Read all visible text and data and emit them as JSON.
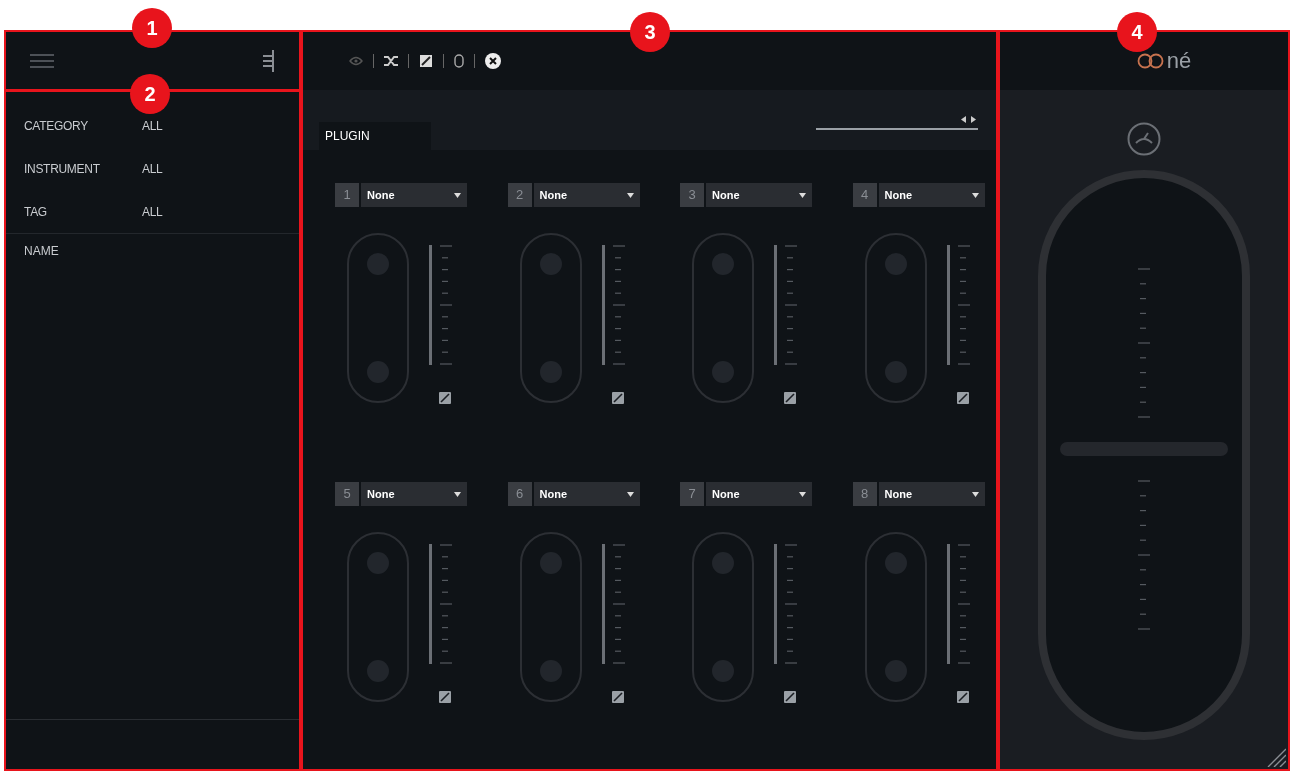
{
  "callouts": [
    "1",
    "2",
    "3",
    "4"
  ],
  "sidebar": {
    "filters": [
      {
        "label": "CATEGORY",
        "value": "ALL"
      },
      {
        "label": "INSTRUMENT",
        "value": "ALL"
      },
      {
        "label": "TAG",
        "value": "ALL"
      }
    ],
    "list_header": "NAME"
  },
  "main": {
    "tab": {
      "label": "PLUGIN",
      "selected": true
    },
    "slots": [
      {
        "number": "1",
        "plugin": "None"
      },
      {
        "number": "2",
        "plugin": "None"
      },
      {
        "number": "3",
        "plugin": "None"
      },
      {
        "number": "4",
        "plugin": "None"
      },
      {
        "number": "5",
        "plugin": "None"
      },
      {
        "number": "6",
        "plugin": "None"
      },
      {
        "number": "7",
        "plugin": "None"
      },
      {
        "number": "8",
        "plugin": "None"
      }
    ]
  },
  "right_panel": {
    "logo_text": "né"
  }
}
